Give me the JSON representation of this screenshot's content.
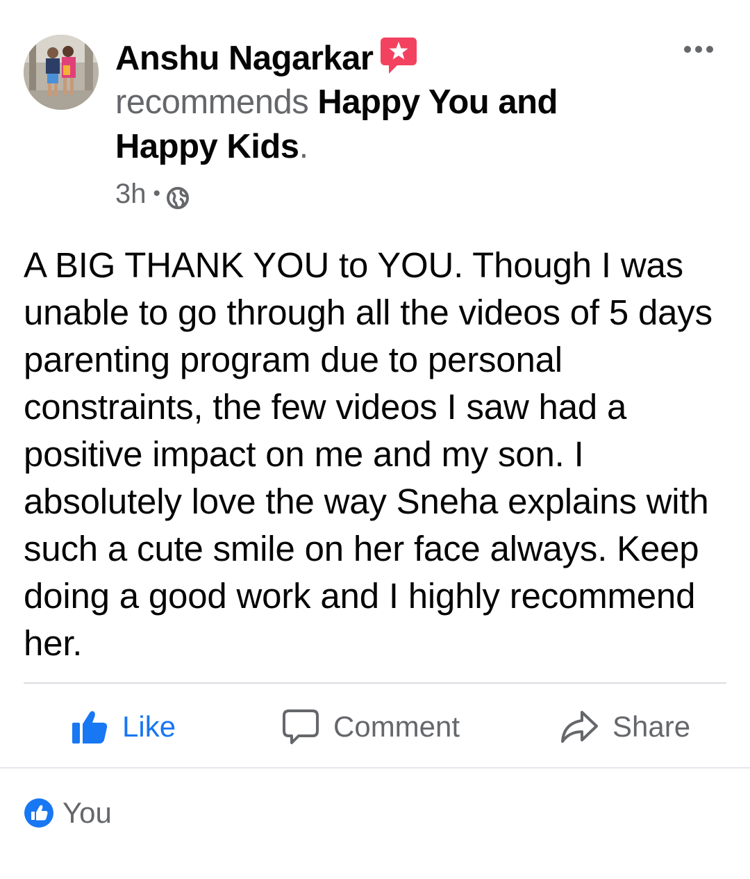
{
  "post": {
    "author": "Anshu Nagarkar",
    "recommends_verb": "recommends",
    "page_name": "Happy You and Happy Kids",
    "period": ".",
    "time": "3h",
    "separator": "•",
    "body": "A BIG THANK YOU to YOU. Though I was unable to go through all the videos of 5 days parenting program due to personal constraints, the few videos I saw had a positive impact on me and my son. I absolutely love the way Sneha explains with such a cute smile on her face always. Keep doing a good work and I highly recommend her."
  },
  "actions": {
    "like_label": "Like",
    "comment_label": "Comment",
    "share_label": "Share"
  },
  "reactions": {
    "names": "You"
  },
  "icons": {
    "recommend_badge": "recommendation-star-icon",
    "more": "more-options-icon",
    "privacy": "globe-icon",
    "like": "thumbs-up-icon",
    "comment": "speech-bubble-icon",
    "share": "share-arrow-icon",
    "reaction": "like-reaction-icon"
  },
  "colors": {
    "like_blue": "#1877f2",
    "secondary_text": "#65676b",
    "recommend_badge": "#f3425f",
    "primary_text": "#050505"
  }
}
